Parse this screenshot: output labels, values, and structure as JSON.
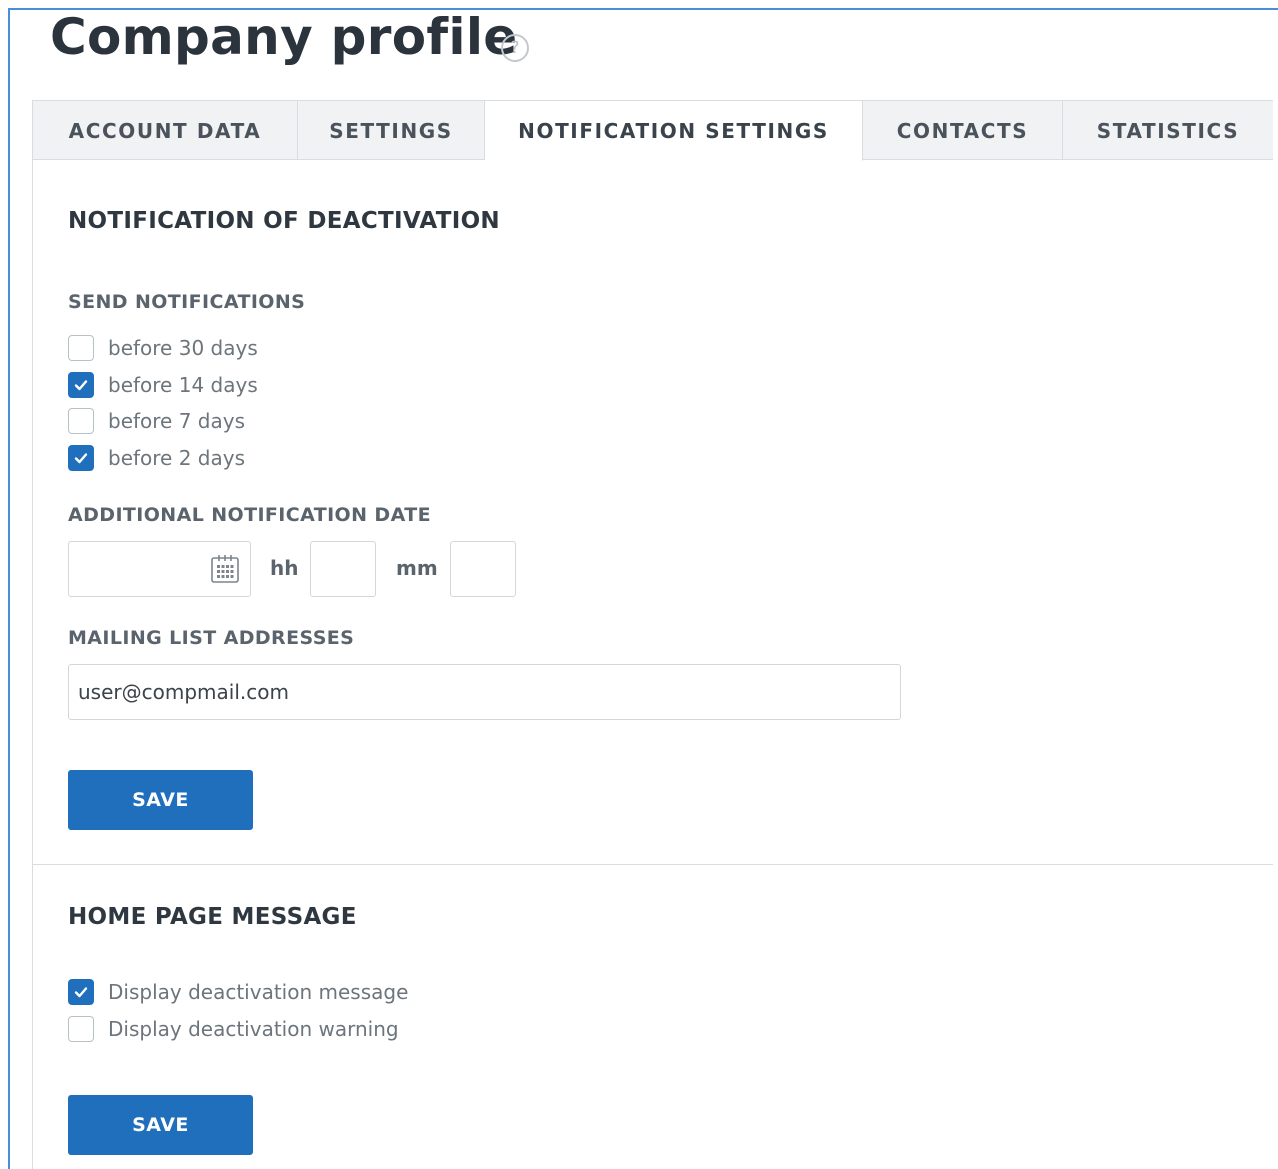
{
  "page": {
    "title": "Company profile",
    "help_glyph": "?"
  },
  "tabs": [
    {
      "label": "ACCOUNT DATA",
      "active": false
    },
    {
      "label": "SETTINGS",
      "active": false
    },
    {
      "label": "NOTIFICATION SETTINGS",
      "active": true
    },
    {
      "label": "CONTACTS",
      "active": false
    },
    {
      "label": "STATISTICS",
      "active": false
    }
  ],
  "deactivation": {
    "title": "NOTIFICATION OF DEACTIVATION",
    "send_label": "SEND NOTIFICATIONS",
    "options": [
      {
        "label": "before 30 days",
        "checked": false
      },
      {
        "label": "before 14 days",
        "checked": true
      },
      {
        "label": "before 7 days",
        "checked": false
      },
      {
        "label": "before 2 days",
        "checked": true
      }
    ],
    "additional_label": "ADDITIONAL NOTIFICATION DATE",
    "date_value": "",
    "hours_label": "hh",
    "hours_value": "",
    "minutes_label": "mm",
    "minutes_value": "",
    "mailing_label": "MAILING LIST ADDRESSES",
    "mailing_value": "user@compmail.com",
    "save_label": "SAVE"
  },
  "home_message": {
    "title": "HOME PAGE MESSAGE",
    "options": [
      {
        "label": "Display deactivation message",
        "checked": true
      },
      {
        "label": "Display deactivation warning",
        "checked": false
      }
    ],
    "save_label": "SAVE"
  },
  "colors": {
    "accent": "#1f6fbd",
    "frame": "#4a8fd6",
    "tab_bg": "#f1f2f3"
  },
  "icons": {
    "help": "question-circle-icon",
    "calendar": "calendar-icon",
    "check": "checkmark-icon"
  }
}
